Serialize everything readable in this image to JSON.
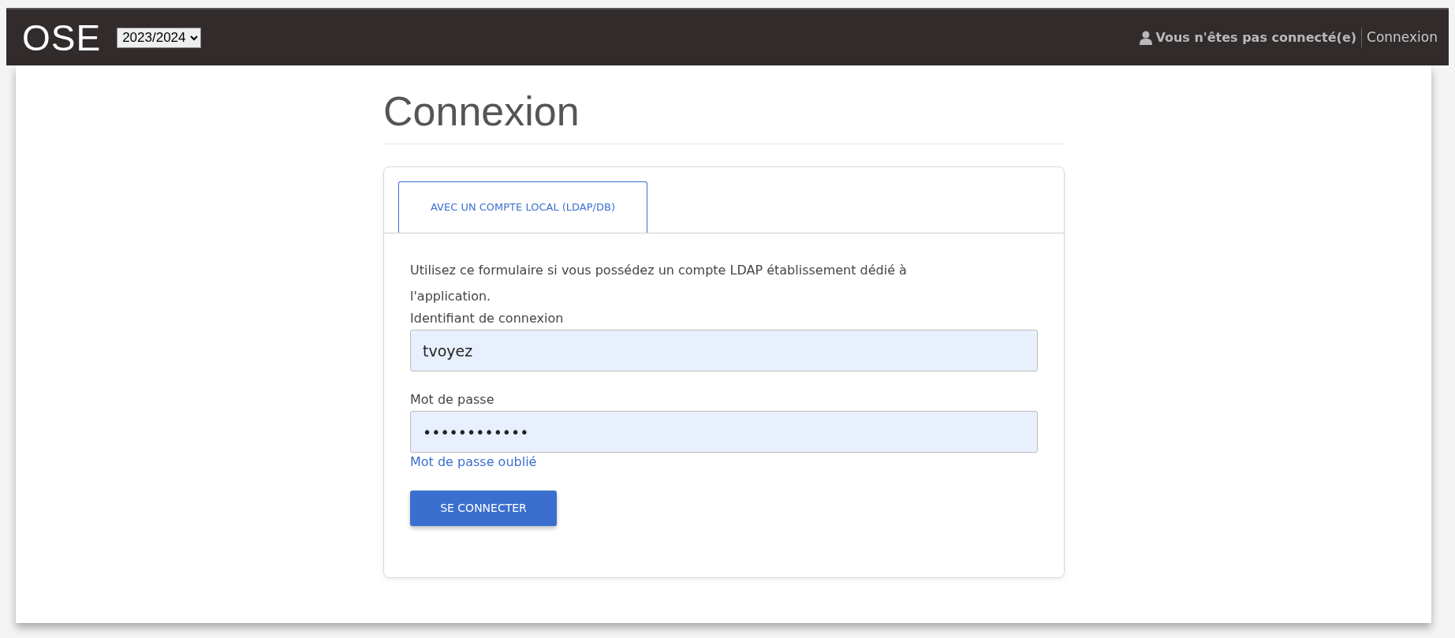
{
  "navbar": {
    "brand": "OSE",
    "year_select": {
      "value": "2023/2024"
    },
    "user_status": "Vous n'êtes pas connecté(e)",
    "login_link": "Connexion"
  },
  "page": {
    "title": "Connexion"
  },
  "tabs": [
    {
      "label": "AVEC UN COMPTE LOCAL (LDAP/DB)",
      "selected": true
    }
  ],
  "form": {
    "intro": "Utilisez ce formulaire si vous possédez un compte LDAP établissement dédié à l'application.",
    "fields": [
      {
        "label": "Identifiant de connexion",
        "value": "tvoyez"
      },
      {
        "label": "Mot de passe",
        "value": "••••••••••••"
      }
    ],
    "forgot_link": "Mot de passe oublié",
    "submit": "SE CONNECTER"
  }
}
